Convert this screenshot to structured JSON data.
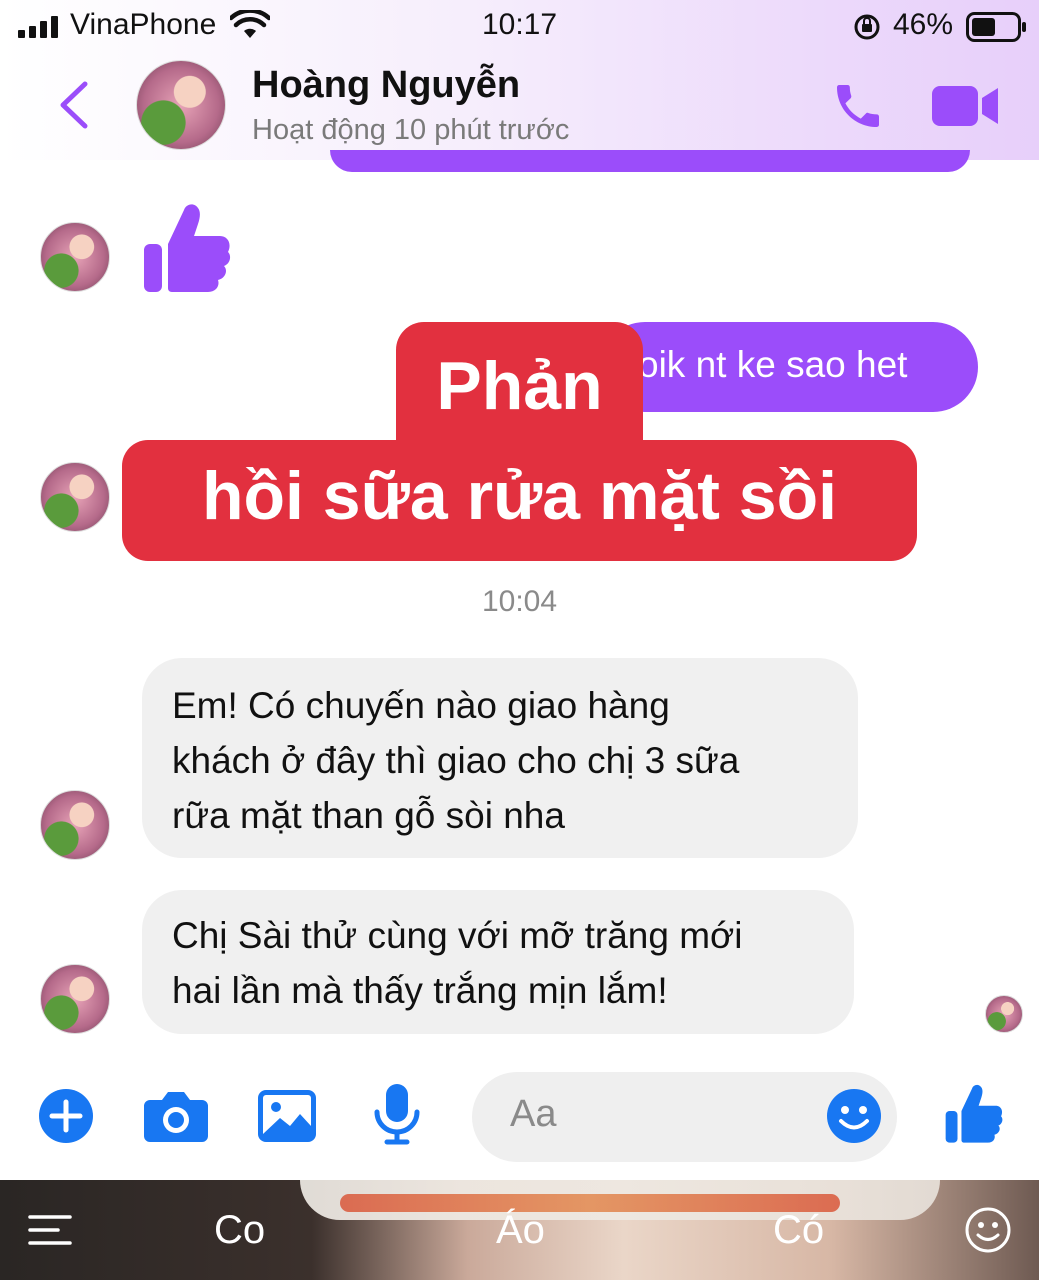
{
  "status_bar": {
    "carrier": "VinaPhone",
    "time": "10:17",
    "battery_percent": "46%"
  },
  "header": {
    "contact_name": "Hoàng Nguyễn",
    "activity_status": "Hoạt động 10 phút trước"
  },
  "messages": {
    "outgoing_text": "biết nt ke sao het",
    "outgoing_visible_fragment": "oik nt ke sao het",
    "timestamp": "10:04",
    "incoming_1": "Em! Có chuyến nào giao hàng khách ở đây thì giao cho chị 3 sữa rữa mặt than gỗ sòi nha",
    "incoming_1_lines": [
      "Em! Có chuyến nào giao hàng",
      "khách ở đây thì giao cho chị 3 sữa",
      "rữa mặt than gỗ sòi nha"
    ],
    "incoming_2_lines": [
      "Chị Sài thử cùng với mỡ trăng mới",
      "hai lần mà thấy trắng mịn lắm!"
    ]
  },
  "caption_overlay": {
    "line1": "Phản",
    "line2": "hồi sữa rửa mặt sồi"
  },
  "composer": {
    "placeholder": "Aa"
  },
  "keyboard_suggestions": [
    "Co",
    "Áo",
    "Có"
  ],
  "colors": {
    "accent_purple": "#9b4dfa",
    "messenger_blue": "#1877f2",
    "caption_red": "#e2303f"
  }
}
